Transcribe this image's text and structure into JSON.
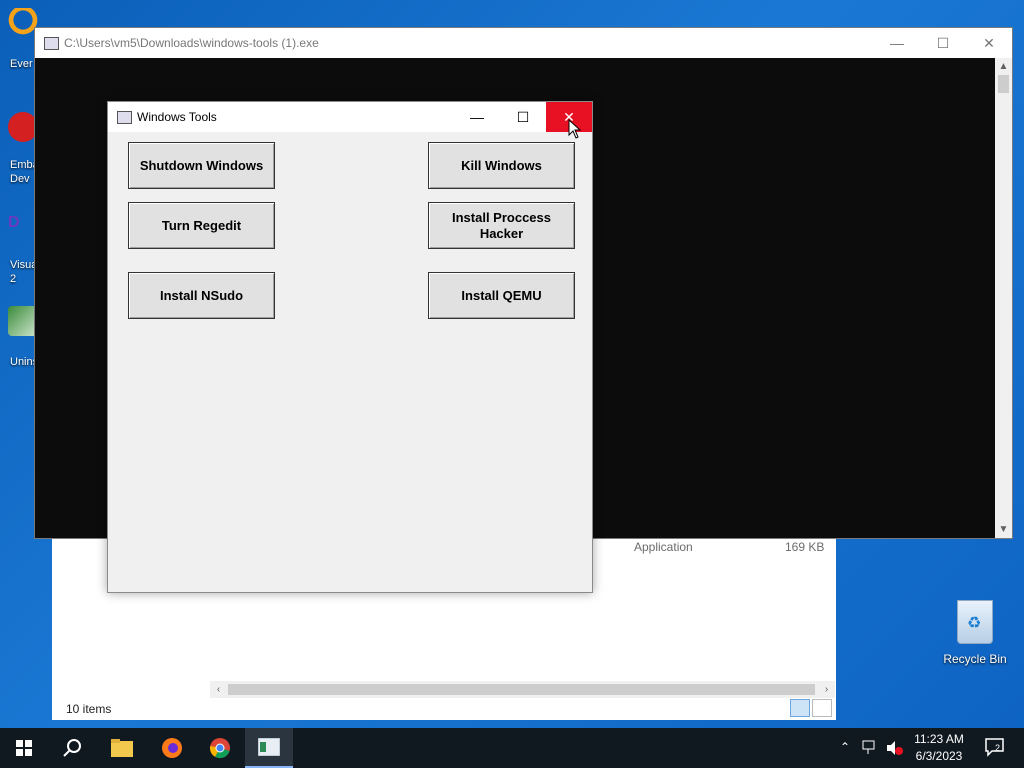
{
  "desktop": {
    "icons": [
      {
        "label": "Ever",
        "color": "#f4a21a"
      },
      {
        "label": "Emba Dev",
        "color": "#d42020"
      },
      {
        "label": "Visua 2",
        "color": "#6a3bbf"
      },
      {
        "label": "Unins",
        "color": "#3b8a3b"
      }
    ],
    "recycle_bin_label": "Recycle Bin"
  },
  "console_window": {
    "title": "C:\\Users\\vm5\\Downloads\\windows-tools (1).exe",
    "minimize": "—",
    "maximize": "☐",
    "close": "✕"
  },
  "explorer": {
    "row_type": "Application",
    "row_size": "169 KB",
    "status": "10 items",
    "scroll_left": "‹",
    "scroll_right": "›"
  },
  "tools_window": {
    "title": "Windows Tools",
    "minimize": "—",
    "maximize": "☐",
    "close": "✕",
    "buttons": {
      "shutdown": "Shutdown Windows",
      "kill": "Kill Windows",
      "regedit": "Turn Regedit",
      "process_hacker": "Install Proccess Hacker",
      "nsudo": "Install NSudo",
      "qemu": "Install QEMU"
    }
  },
  "taskbar": {
    "time": "11:23 AM",
    "date": "6/3/2023",
    "notification_count": "2",
    "icons": [
      "start-icon",
      "search-icon",
      "file-explorer-icon",
      "firefox-icon",
      "chrome-icon",
      "windows-tools-app-icon"
    ]
  },
  "colors": {
    "close_hover": "#e81123",
    "desktop": "#1a78d4",
    "taskbar": "#101820"
  }
}
